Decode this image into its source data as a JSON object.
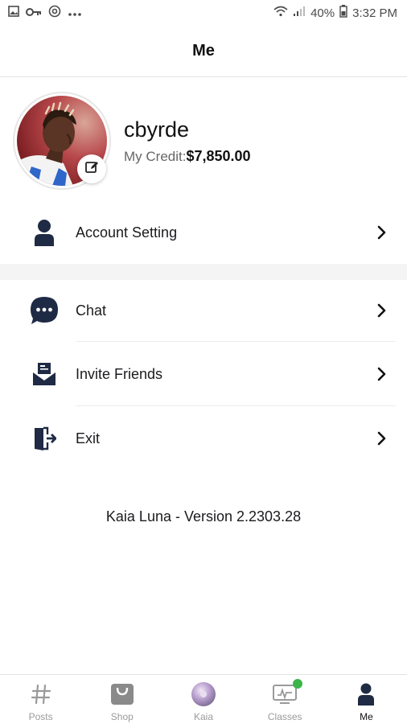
{
  "status_bar": {
    "battery": "40%",
    "time": "3:32 PM",
    "left_icons": [
      "image-icon",
      "key-icon",
      "at-sign-icon",
      "more-dots-icon"
    ],
    "right_icons": [
      "wifi-icon",
      "signal-icon",
      "battery-icon"
    ]
  },
  "header": {
    "title": "Me"
  },
  "profile": {
    "username": "cbyrde",
    "credit_label": "My Credit:",
    "credit_value": "$7,850.00",
    "avatar_icon": "profile-photo",
    "edit_icon": "edit-icon"
  },
  "menu": [
    {
      "label": "Account Setting",
      "icon": "user-icon"
    },
    {
      "label": "Chat",
      "icon": "chat-bubble-icon"
    },
    {
      "label": "Invite Friends",
      "icon": "mail-invite-icon"
    },
    {
      "label": "Exit",
      "icon": "exit-door-icon"
    }
  ],
  "version": "Kaia Luna - Version 2.2303.28",
  "bottom_nav": [
    {
      "label": "Posts",
      "icon": "hash-icon",
      "active": false
    },
    {
      "label": "Shop",
      "icon": "shopping-bag-icon",
      "active": false
    },
    {
      "label": "Kaia",
      "icon": "kaia-orb-icon",
      "active": false
    },
    {
      "label": "Classes",
      "icon": "classes-screen-icon",
      "active": false,
      "badge": true
    },
    {
      "label": "Me",
      "icon": "user-icon",
      "active": true
    }
  ],
  "colors": {
    "icon_dark": "#1f2a44",
    "badge_green": "#3bb54a",
    "inactive_nav": "#9a9a9a"
  }
}
